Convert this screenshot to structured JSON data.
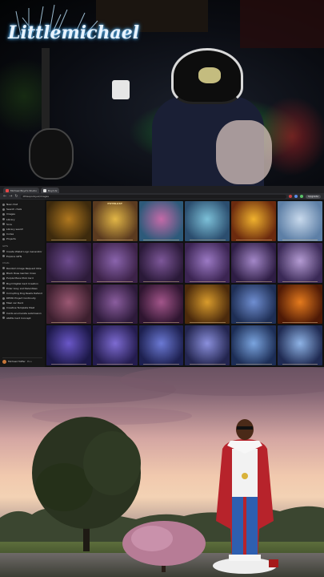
{
  "overlay": {
    "logo_text": "Littlemichael"
  },
  "browser": {
    "tabs": [
      {
        "title": "Michael Boyd's Studio",
        "active": false
      },
      {
        "title": "Boyd AI",
        "active": true
      }
    ],
    "address": "littlespooky.ai/images",
    "upgrade_label": "Upgrade",
    "sidebar": {
      "primary": [
        {
          "label": "New chat",
          "icon": "compose-icon"
        },
        {
          "label": "Search chats",
          "icon": "search-icon"
        },
        {
          "label": "Images",
          "icon": "image-icon"
        },
        {
          "label": "Library",
          "icon": "library-icon"
        },
        {
          "label": "Sora",
          "icon": "sora-icon"
        },
        {
          "label": "Library search",
          "icon": "book-icon"
        },
        {
          "label": "Codex",
          "icon": "code-icon"
        },
        {
          "label": "Projects",
          "icon": "folder-icon"
        }
      ],
      "gpts_header": "GPTs",
      "gpts": [
        {
          "label": "Create Wallet Logo Generator",
          "icon": "gpt-icon"
        },
        {
          "label": "Explore GPTs",
          "icon": "grid-icon"
        }
      ],
      "chats_header": "Chats",
      "chats": [
        "Random Image Request Vote",
        "Black Rose Garden Crew",
        "Purple Mace Mob Card",
        "Boyd Digital Card Creation",
        "Elder Grey and Relentless",
        "Corrupting Dog Reads Defender",
        "DEMO Project Continuity",
        "Mael ver Deck",
        "Creative Template Maid",
        "Cards enumerate submission",
        "AKWG Card Concept"
      ],
      "user_name": "Michael Hoffer",
      "user_plan": "Plus"
    },
    "gallery": {
      "tiles": [
        {
          "caption": "",
          "c1": "#3d2a0d",
          "c2": "#b0781f"
        },
        {
          "caption": "PSYBLAST",
          "c1": "#5a3a1f",
          "c2": "#e2b646"
        },
        {
          "caption": "",
          "c1": "#2d5a7a",
          "c2": "#c46aa8"
        },
        {
          "caption": "",
          "c1": "#2b4d6e",
          "c2": "#7cc0d8"
        },
        {
          "caption": "",
          "c1": "#6b2a0e",
          "c2": "#f0b22e"
        },
        {
          "caption": "",
          "c1": "#5d7fa6",
          "c2": "#c8d9ec"
        },
        {
          "caption": "",
          "c1": "#2d1b3a",
          "c2": "#6d4b8e"
        },
        {
          "caption": "",
          "c1": "#3c2248",
          "c2": "#8a64ad"
        },
        {
          "caption": "",
          "c1": "#2a1938",
          "c2": "#7d5799"
        },
        {
          "caption": "",
          "c1": "#3b2452",
          "c2": "#9b79c4"
        },
        {
          "caption": "",
          "c1": "#2e1d44",
          "c2": "#a387c8"
        },
        {
          "caption": "",
          "c1": "#3a2956",
          "c2": "#b49bd3"
        },
        {
          "caption": "",
          "c1": "#3c1f2e",
          "c2": "#9b5873"
        },
        {
          "caption": "",
          "c1": "#2d1a3a",
          "c2": "#8a5d9e"
        },
        {
          "caption": "",
          "c1": "#2f1530",
          "c2": "#a2558a"
        },
        {
          "caption": "",
          "c1": "#4b2a0c",
          "c2": "#d89b2c"
        },
        {
          "caption": "",
          "c1": "#1e2e54",
          "c2": "#6f8ed1"
        },
        {
          "caption": "",
          "c1": "#4f1a06",
          "c2": "#e47a1d"
        },
        {
          "caption": "",
          "c1": "#1c1848",
          "c2": "#6a57c8"
        },
        {
          "caption": "",
          "c1": "#241c4e",
          "c2": "#7d6bd2"
        },
        {
          "caption": "",
          "c1": "#1d2050",
          "c2": "#6b79d4"
        },
        {
          "caption": "",
          "c1": "#23254f",
          "c2": "#8a8fdc"
        },
        {
          "caption": "",
          "c1": "#1c2d55",
          "c2": "#7aa4df"
        },
        {
          "caption": "",
          "c1": "#1f2a52",
          "c2": "#8eb3e6"
        }
      ]
    }
  },
  "colors": {
    "browser_bg": "#202124",
    "sidebar_bg": "#171717",
    "logo_glow": "#6dc6ff",
    "sky_pink": "#f1c9ae",
    "coat_red": "#b7232b"
  }
}
